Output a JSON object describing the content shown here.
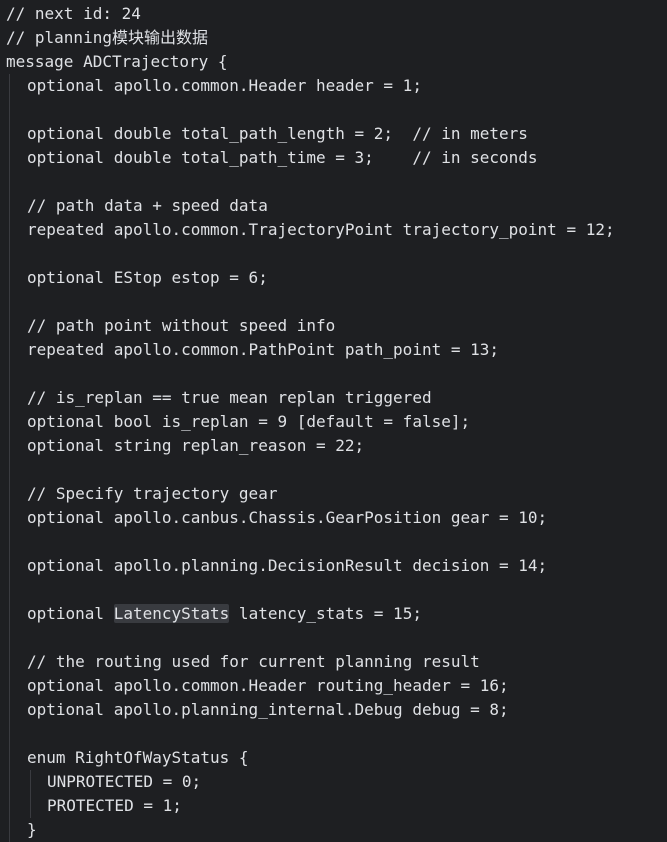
{
  "lines": [
    {
      "text": "// next id: 24"
    },
    {
      "text": "// planning模块输出数据"
    },
    {
      "text": "message ADCTrajectory {"
    },
    {
      "text": "optional apollo.common.Header header = 1;"
    },
    {
      "text": ""
    },
    {
      "text": "optional double total_path_length = 2;  // in meters"
    },
    {
      "text": "optional double total_path_time = 3;    // in seconds"
    },
    {
      "text": ""
    },
    {
      "text": "// path data + speed data"
    },
    {
      "text": "repeated apollo.common.TrajectoryPoint trajectory_point = 12;"
    },
    {
      "text": ""
    },
    {
      "text": "optional EStop estop = 6;"
    },
    {
      "text": ""
    },
    {
      "text": "// path point without speed info"
    },
    {
      "text": "repeated apollo.common.PathPoint path_point = 13;"
    },
    {
      "text": ""
    },
    {
      "text": "// is_replan == true mean replan triggered"
    },
    {
      "text": "optional bool is_replan = 9 [default = false];"
    },
    {
      "text": "optional string replan_reason = 22;"
    },
    {
      "text": ""
    },
    {
      "text": "// Specify trajectory gear"
    },
    {
      "text": "optional apollo.canbus.Chassis.GearPosition gear = 10;"
    },
    {
      "text": ""
    },
    {
      "text": "optional apollo.planning.DecisionResult decision = 14;"
    },
    {
      "text": ""
    },
    {
      "pre": "optional ",
      "highlight": "LatencyStats",
      "post": " latency_stats = 15;"
    },
    {
      "text": ""
    },
    {
      "text": "// the routing used for current planning result"
    },
    {
      "text": "optional apollo.common.Header routing_header = 16;"
    },
    {
      "text": "optional apollo.planning_internal.Debug debug = 8;"
    },
    {
      "text": ""
    },
    {
      "text": "enum RightOfWayStatus {"
    },
    {
      "text": "UNPROTECTED = 0;"
    },
    {
      "text": "PROTECTED = 1;"
    },
    {
      "text": "}"
    }
  ]
}
